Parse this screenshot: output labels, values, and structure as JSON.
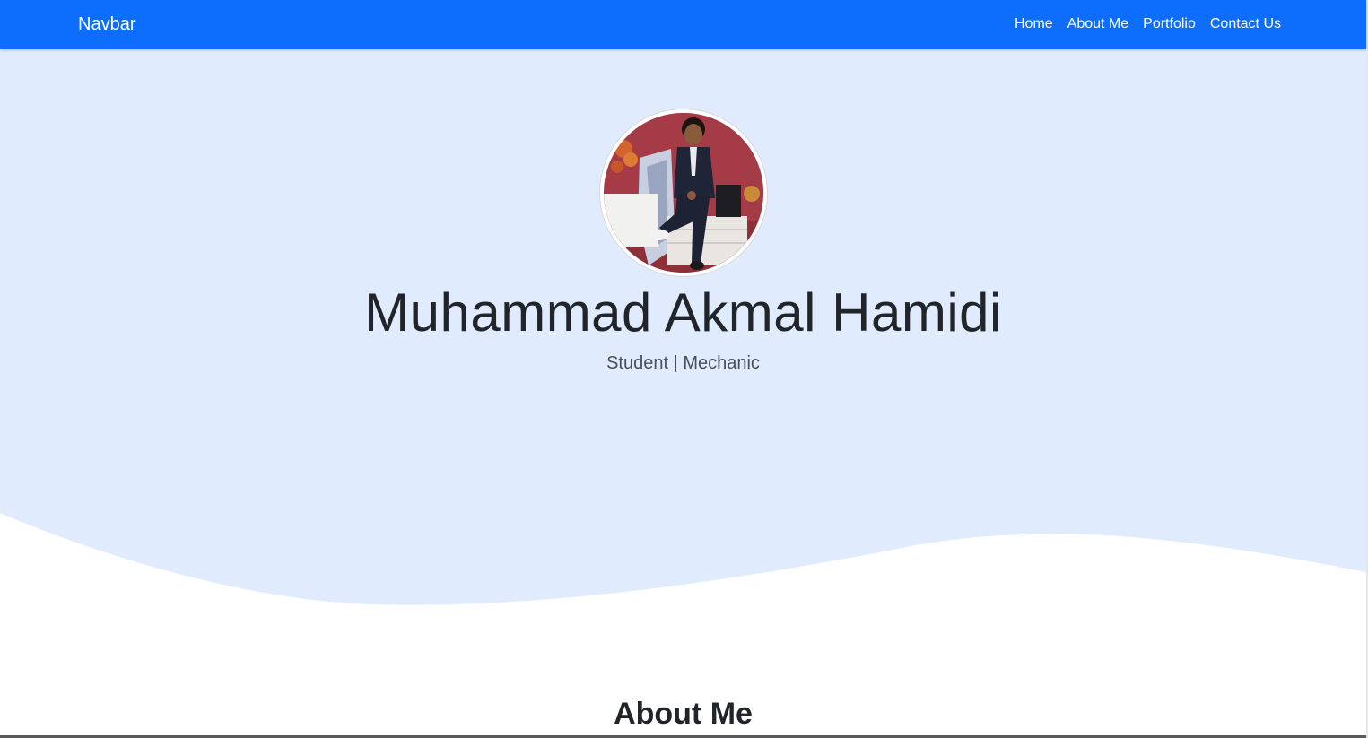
{
  "navbar": {
    "brand": "Navbar",
    "links": [
      "Home",
      "About Me",
      "Portfolio",
      "Contact Us"
    ],
    "bg_color": "#0d6efd"
  },
  "hero": {
    "name": "Muhammad Akmal Hamidi",
    "subtitle": "Student | Mechanic",
    "bg_color": "#e0ebfd"
  },
  "about": {
    "title": "About Me"
  }
}
